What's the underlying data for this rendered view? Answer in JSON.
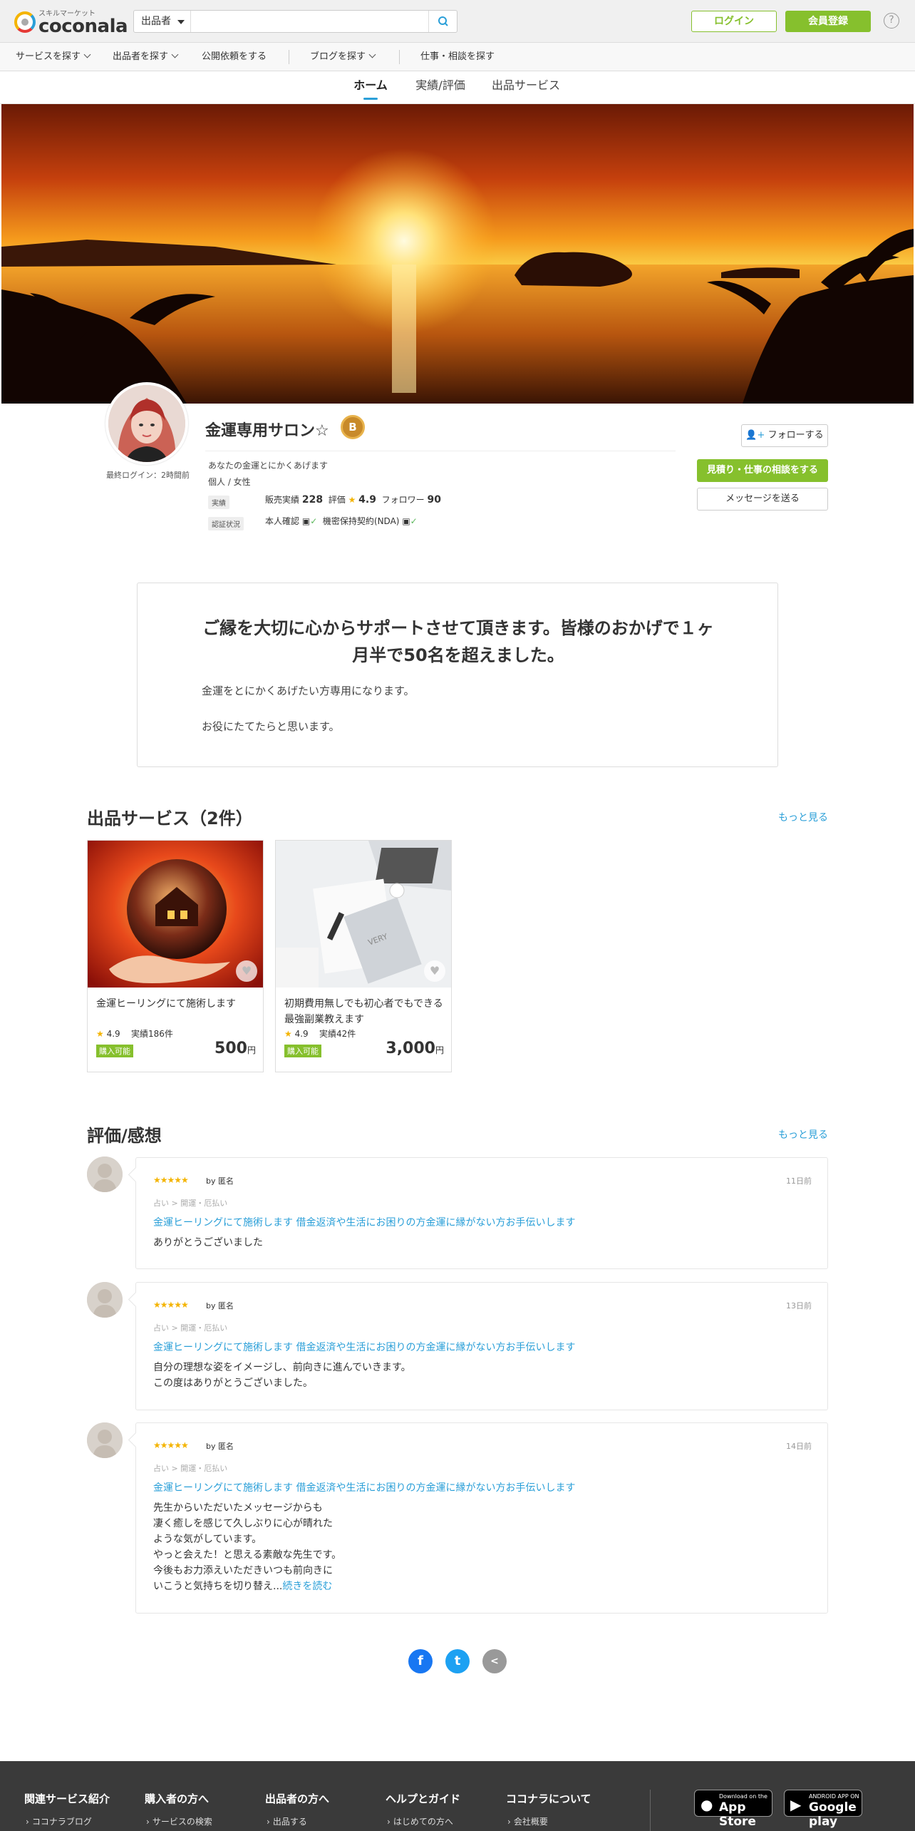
{
  "header": {
    "logo_tag": "スキルマーケット",
    "logo_word": "coconala",
    "search_select": "出品者",
    "search_placeholder": "",
    "login": "ログイン",
    "register": "会員登録",
    "help": "?"
  },
  "nav": {
    "items": [
      "サービスを探す",
      "出品者を探す",
      "公開依頼をする",
      "ブログを探す",
      "仕事・相談を探す"
    ]
  },
  "tabs": [
    "ホーム",
    "実績/評価",
    "出品サービス"
  ],
  "profile": {
    "last_login": "最終ログイン：2時間前",
    "name": "金運専用サロン☆",
    "rank_badge": "B",
    "catchphrase": "あなたの金運とにかくあげます",
    "attributes": "個人 / 女性",
    "label_results": "実績",
    "label_verified": "認証状況",
    "sales_label": "販売実績",
    "sales_value": "228",
    "rating_label": "評価",
    "rating_value": "4.9",
    "follower_label": "フォロワー",
    "follower_value": "90",
    "identity_verified": "本人確認",
    "nda": "機密保持契約(NDA)",
    "follow_button": "フォローする",
    "quote_button": "見積り・仕事の相談をする",
    "message_button": "メッセージを送る"
  },
  "intro": {
    "title": "ご縁を大切に心からサポートさせて頂きます。皆様のおかげで１ヶ月半で50名を超えました。",
    "line1": "金運をとにかくあげたい方専用になります。",
    "line2": "お役にたてたらと思います。"
  },
  "services": {
    "heading": "出品サービス（2件）",
    "more": "もっと見る",
    "items": [
      {
        "title": "金運ヒーリングにて施術します",
        "rating": "4.9",
        "results_label": "実績",
        "results": "186件",
        "status": "購入可能",
        "price": "500",
        "currency": "円"
      },
      {
        "title": "初期費用無しでも初心者でもできる最強副業教えます",
        "rating": "4.9",
        "results_label": "実績",
        "results": "42件",
        "status": "購入可能",
        "price": "3,000",
        "currency": "円"
      }
    ]
  },
  "reviews": {
    "heading": "評価/感想",
    "more": "もっと見る",
    "items": [
      {
        "stars": "★★★★★",
        "by": "by 匿名",
        "date": "11日前",
        "category": "占い > 開運・厄払い",
        "service": "金運ヒーリングにて施術します 借金返済や生活にお困りの方金運に縁がない方お手伝いします",
        "text": [
          "ありがとうございました"
        ]
      },
      {
        "stars": "★★★★★",
        "by": "by 匿名",
        "date": "13日前",
        "category": "占い > 開運・厄払い",
        "service": "金運ヒーリングにて施術します 借金返済や生活にお困りの方金運に縁がない方お手伝いします",
        "text": [
          "自分の理想な姿をイメージし、前向きに進んでいきます。",
          "この度はありがとうございました。"
        ]
      },
      {
        "stars": "★★★★★",
        "by": "by 匿名",
        "date": "14日前",
        "category": "占い > 開運・厄払い",
        "service": "金運ヒーリングにて施術します 借金返済や生活にお困りの方金運に縁がない方お手伝いします",
        "text": [
          "先生からいただいたメッセージからも",
          "凄く癒しを感じて久しぶりに心が晴れた",
          "ような気がしています。",
          "やっと会えた！と思える素敵な先生です。",
          "今後もお力添えいただきいつも前向きに",
          "いこうと気持ちを切り替え..."
        ],
        "read_more": "続きを読む"
      }
    ]
  },
  "share": {
    "facebook": "f",
    "twitter": "t",
    "other": "<"
  },
  "footer": {
    "columns": [
      {
        "title": "関連サービス紹介",
        "link": "ココナラブログ"
      },
      {
        "title": "購入者の方へ",
        "link": "サービスの検索"
      },
      {
        "title": "出品者の方へ",
        "link": "出品する"
      },
      {
        "title": "ヘルプとガイド",
        "link": "はじめての方へ"
      },
      {
        "title": "ココナラについて",
        "link": "会社概要"
      }
    ],
    "appstore_small": "Download on the",
    "appstore_big": "App Store",
    "googleplay_small": "ANDROID APP ON",
    "googleplay_big": "Google play"
  },
  "colors": {
    "accent_green": "#86c02d",
    "link_blue": "#2a9fd8",
    "star_yellow": "#f4b400",
    "footer_bg": "#3a3a3a"
  }
}
